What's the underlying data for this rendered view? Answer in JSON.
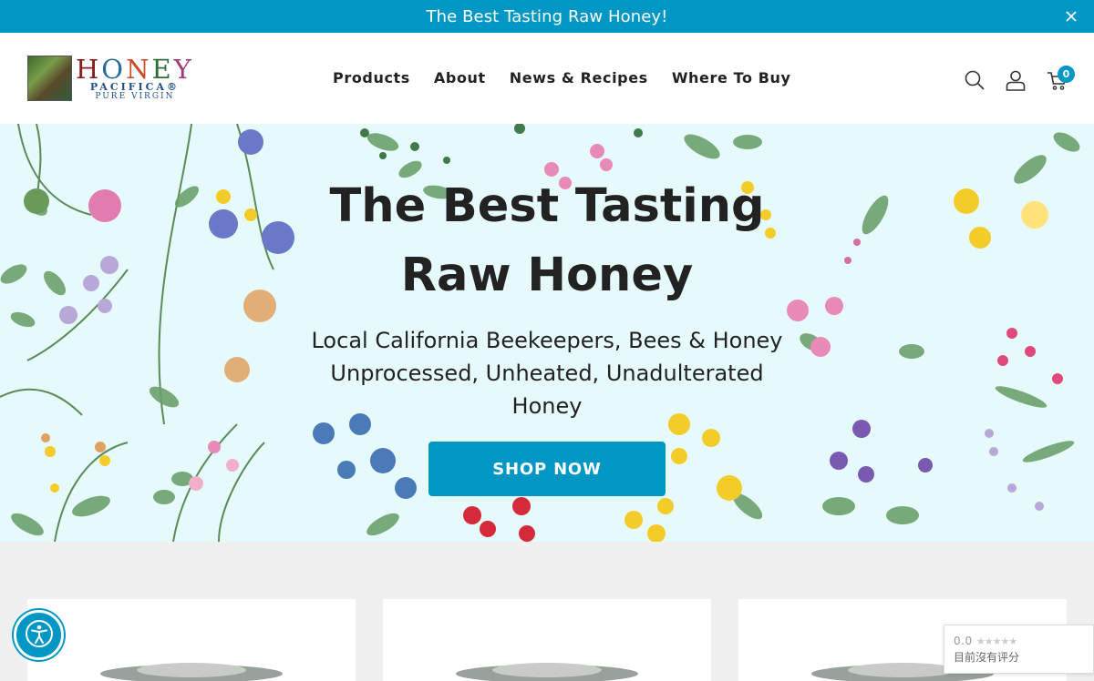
{
  "announcement": {
    "text": "The Best Tasting Raw Honey!",
    "close_icon": "close-icon"
  },
  "header": {
    "logo": {
      "word": [
        "H",
        "O",
        "N",
        "E",
        "Y"
      ],
      "line2": "PACIFICA®",
      "line3": "PURE VIRGIN"
    },
    "nav": [
      "Products",
      "About",
      "News & Recipes",
      "Where To Buy"
    ],
    "icons": [
      "search-icon",
      "user-icon",
      "cart-icon"
    ],
    "cart_count": "0"
  },
  "hero": {
    "title_line1": "The Best Tasting",
    "title_line2": "Raw Honey",
    "sub_line1": "Local California Beekeepers, Bees & Honey",
    "sub_line2": "Unprocessed, Unheated, Unadulterated Honey",
    "button": "SHOP NOW"
  },
  "review_badge": {
    "score": "0.0",
    "stars": "★★★★★",
    "label": "目前沒有评分"
  },
  "colors": {
    "accent": "#0097c4",
    "hero_bg": "#e6fafb",
    "section_bg": "#f0f0f0"
  }
}
